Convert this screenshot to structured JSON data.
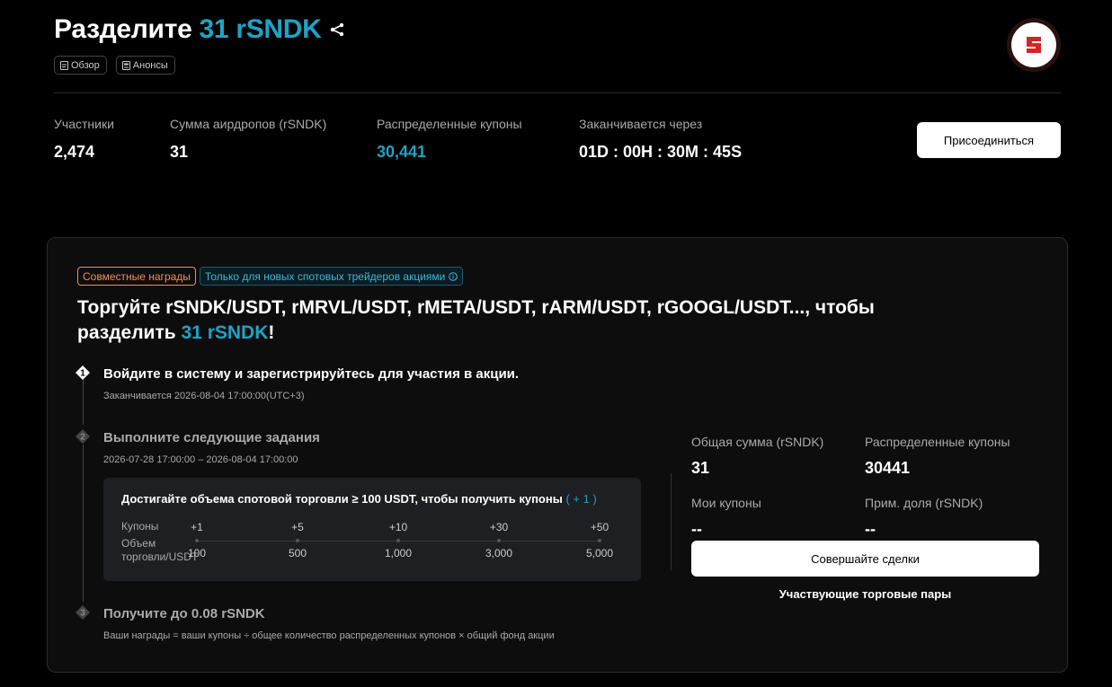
{
  "header": {
    "title_prefix": "Разделите",
    "title_accent": "31 rSNDK",
    "tags": [
      "Обзор",
      "Анонсы"
    ]
  },
  "stats": [
    {
      "label": "Участники",
      "value": "2,474",
      "accent": false
    },
    {
      "label": "Сумма аирдропов (rSNDK)",
      "value": "31",
      "accent": false
    },
    {
      "label": "Распределенные купоны",
      "value": "30,441",
      "accent": true
    },
    {
      "label": "Заканчивается через",
      "value": "01D : 00H : 30M : 45S",
      "accent": false
    }
  ],
  "join_label": "Присоединиться",
  "card": {
    "badge_reward": "Совместные награды",
    "badge_new": "Только для новых спотовых трейдеров акциями",
    "title_main": "Торгуйте rSNDK/USDT, rMRVL/USDT, rMETA/USDT, rARM/USDT, rGOOGL/USDT..., чтобы разделить ",
    "title_accent": "31 rSNDK",
    "title_end": "!"
  },
  "steps": [
    {
      "num": "1",
      "title": "Войдите в систему и зарегистрируйтесь для участия в акции.",
      "sub": "Заканчивается 2026-08-04 17:00:00(UTC+3)"
    },
    {
      "num": "2",
      "title": "Выполните следующие задания",
      "sub": "2026-07-28 17:00:00 – 2026-08-04 17:00:00"
    },
    {
      "num": "3",
      "title": "Получите до 0.08 rSNDK",
      "sub": "Ваши награды = ваши купоны ÷ общее количество распределенных купонов × общий фонд акции"
    }
  ],
  "task": {
    "title": "Достигайте объема спотовой торговли ≥ 100 USDT, чтобы получить купоны",
    "title_accent": "( + 1 )",
    "coupons_label": "Купоны",
    "volume_label": "Объем торговли/USDT",
    "coupons": [
      "+1",
      "+5",
      "+10",
      "+30",
      "+50"
    ],
    "volumes": [
      "100",
      "500",
      "1,000",
      "3,000",
      "5,000"
    ]
  },
  "summary": {
    "total_label": "Общая сумма (rSNDK)",
    "total_value": "31",
    "distributed_label": "Распределенные купоны",
    "distributed_value": "30441",
    "my_label": "Мои купоны",
    "my_value": "--",
    "share_label": "Прим. доля (rSNDK)",
    "share_value": "--"
  },
  "trade_label": "Совершайте сделки",
  "pairs_label": "Участвующие торговые пары",
  "colors": {
    "accent": "#1fa3c4",
    "badge_orange": "#f58c5a",
    "logo_red": "#d42525"
  }
}
